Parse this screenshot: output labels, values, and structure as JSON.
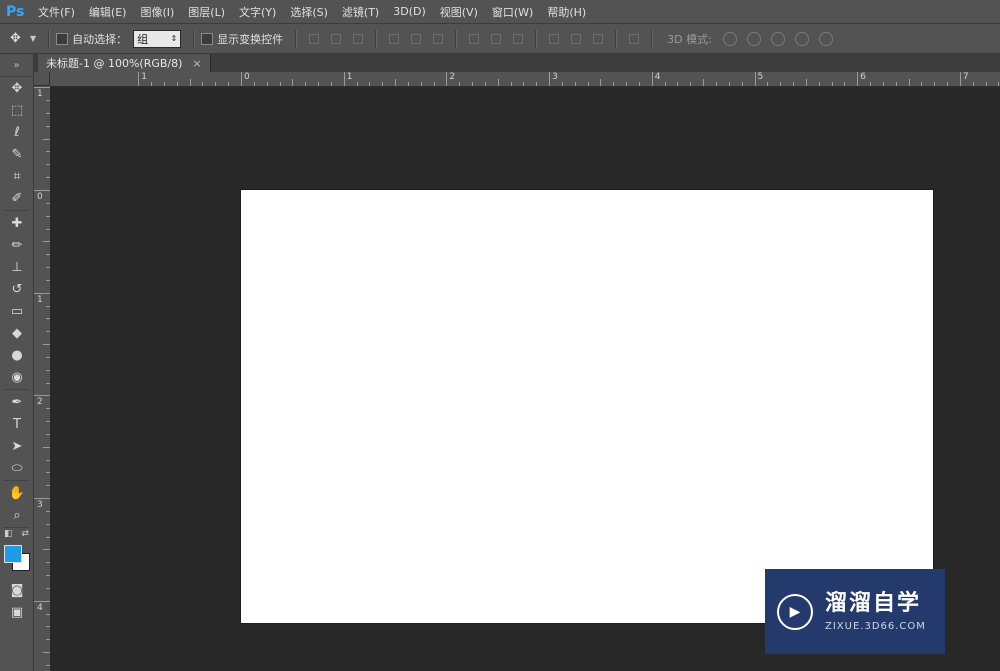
{
  "app": {
    "logo": "Ps"
  },
  "menu": [
    "文件(F)",
    "编辑(E)",
    "图像(I)",
    "图层(L)",
    "文字(Y)",
    "选择(S)",
    "滤镜(T)",
    "3D(D)",
    "视图(V)",
    "窗口(W)",
    "帮助(H)"
  ],
  "options": {
    "auto_select_label": "自动选择：",
    "auto_select_value": "组",
    "show_transform_label": "显示变换控件",
    "mode_3d_label": "3D 模式:"
  },
  "tab": {
    "title": "未标题-1 @ 100%(RGB/8)",
    "close": "×"
  },
  "ruler": {
    "h_labels": [
      "1",
      "0",
      "1",
      "2",
      "3",
      "4",
      "5",
      "6",
      "7"
    ],
    "v_labels": [
      "1",
      "0",
      "1",
      "2",
      "3",
      "4"
    ]
  },
  "tools": [
    {
      "name": "move-tool-icon",
      "glyph": "✥"
    },
    {
      "name": "marquee-tool-icon",
      "glyph": "⬚"
    },
    {
      "name": "lasso-tool-icon",
      "glyph": "ℓ"
    },
    {
      "name": "quick-select-tool-icon",
      "glyph": "✎"
    },
    {
      "name": "crop-tool-icon",
      "glyph": "⌗"
    },
    {
      "name": "eyedropper-tool-icon",
      "glyph": "✐"
    },
    {
      "name": "healing-brush-tool-icon",
      "glyph": "✚"
    },
    {
      "name": "brush-tool-icon",
      "glyph": "✏"
    },
    {
      "name": "stamp-tool-icon",
      "glyph": "⊥"
    },
    {
      "name": "history-brush-tool-icon",
      "glyph": "↺"
    },
    {
      "name": "eraser-tool-icon",
      "glyph": "▭"
    },
    {
      "name": "paint-bucket-tool-icon",
      "glyph": "◆"
    },
    {
      "name": "dodge-tool-icon",
      "glyph": "●"
    },
    {
      "name": "sponge-tool-icon",
      "glyph": "◉"
    },
    {
      "name": "pen-tool-icon",
      "glyph": "✒"
    },
    {
      "name": "type-tool-icon",
      "glyph": "T"
    },
    {
      "name": "path-select-tool-icon",
      "glyph": "➤"
    },
    {
      "name": "ellipse-tool-icon",
      "glyph": "⬭"
    },
    {
      "name": "hand-tool-icon",
      "glyph": "✋"
    },
    {
      "name": "zoom-tool-icon",
      "glyph": "⌕"
    }
  ],
  "colors": {
    "foreground": "#1e9ce6",
    "background": "#ffffff",
    "canvas": "#ffffff",
    "workspace": "#282828",
    "panel": "#535353"
  },
  "watermark": {
    "title": "溜溜自学",
    "subtitle": "ZIXUE.3D66.COM"
  }
}
